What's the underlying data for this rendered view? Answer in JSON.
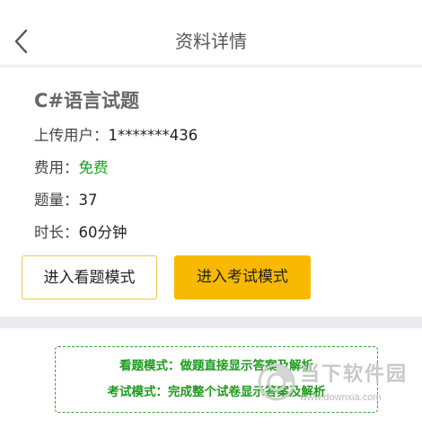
{
  "header": {
    "title": "资料详情",
    "back_icon": "chevron-left-icon"
  },
  "document": {
    "title": "C#语言试题",
    "uploader_label": "上传用户：",
    "uploader_value": "1*******436",
    "fee_label": "费用：",
    "fee_value": "免费",
    "count_label": "题量：",
    "count_value": "37",
    "duration_label": "时长：",
    "duration_value": "60分钟"
  },
  "actions": {
    "view_mode_label": "进入看题模式",
    "exam_mode_label": "进入考试模式"
  },
  "notes": {
    "view_mode_note": "看题模式：做题直接显示答案及解析",
    "exam_mode_note": "考试模式：完成整个试卷显示答案及解析"
  },
  "watermark": {
    "brand": "当下软件园",
    "url": "www.downxia.com"
  },
  "colors": {
    "accent": "#f8b900",
    "free_green": "#18a118",
    "note_green": "#1d9a1d"
  }
}
